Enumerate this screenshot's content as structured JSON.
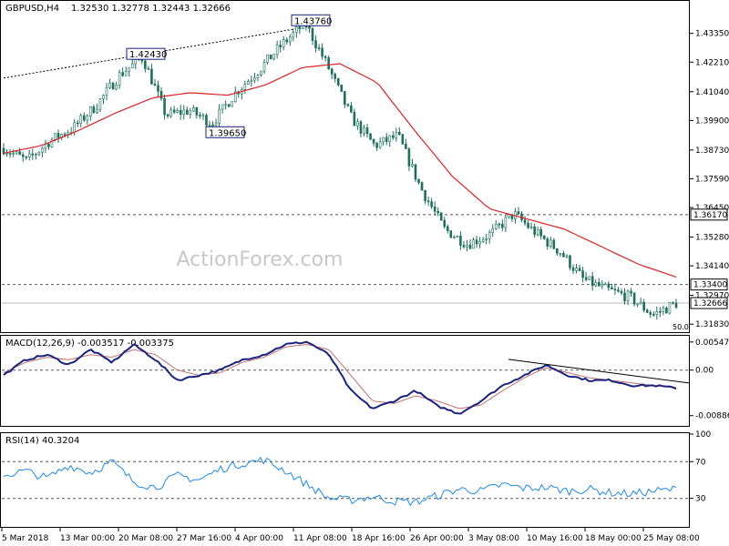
{
  "header": {
    "symbol_tf": "GBPUSD,H4",
    "ohlc": "1.32530 1.32778 1.32443 1.32666"
  },
  "watermark": "ActionForex.com",
  "colors": {
    "candle": "#1f6f5c",
    "ma": "#dd2222",
    "macd": "#1a237e",
    "signal": "#c07070",
    "rsi": "#1e88e5",
    "guide": "#555555",
    "label_border": "#1a237e"
  },
  "chart_data": [
    {
      "type": "candlestick",
      "title": "GBPUSD,H4",
      "ylim": [
        1.3155,
        1.446
      ],
      "y_ticks": [
        "1.43350",
        "1.42210",
        "1.41040",
        "1.39900",
        "1.38730",
        "1.37590",
        "1.36450",
        "1.35280",
        "1.34140",
        "1.32970",
        "1.31830"
      ],
      "x_ticks": [
        "5 Mar 2018",
        "13 Mar 00:00",
        "20 Mar 08:00",
        "27 Mar 16:00",
        "4 Apr 00:00",
        "11 Apr 08:00",
        "18 Apr 16:00",
        "26 Apr 00:00",
        "3 May 08:00",
        "10 May 16:00",
        "18 May 00:00",
        "25 May 08:00"
      ],
      "series": [
        {
          "name": "",
          "kind": "moving-average",
          "values": [
            1.386,
            1.389,
            1.395,
            1.402,
            1.408,
            1.41,
            1.409,
            1.413,
            1.42,
            1.4215,
            1.414,
            1.395,
            1.377,
            1.364,
            1.36,
            1.356,
            1.349,
            1.342,
            1.337
          ]
        }
      ],
      "close_path": [
        1.388,
        1.383,
        1.391,
        1.396,
        1.405,
        1.417,
        1.424,
        1.401,
        1.403,
        1.398,
        1.41,
        1.419,
        1.429,
        1.4376,
        1.42,
        1.4,
        1.389,
        1.393,
        1.372,
        1.356,
        1.35,
        1.354,
        1.362,
        1.354,
        1.347,
        1.336,
        1.332,
        1.329,
        1.322,
        1.3266
      ],
      "horizontal_levels": [
        "1.36170",
        "1.33400"
      ],
      "current_price": "1.32666",
      "price_labels": [
        "1.43760",
        "1.42430",
        "1.39650"
      ],
      "annotations": [
        "50.0"
      ]
    },
    {
      "type": "line",
      "title": "MACD(12,26,9) -0.003517 -0.003375",
      "ylim": [
        -0.0105,
        0.0065
      ],
      "y_ticks": [
        "0.00547",
        "0.00",
        "-0.00886"
      ],
      "series": [
        {
          "name": "",
          "values": [
            -0.001,
            0.002,
            0.003,
            0.001,
            0.004,
            0.0015,
            0.005,
            0.002,
            -0.002,
            -0.001,
            0.0,
            0.002,
            0.003,
            0.005,
            0.0055,
            0.003,
            -0.004,
            -0.0075,
            -0.006,
            -0.004,
            -0.007,
            -0.0085,
            -0.006,
            -0.003,
            -0.001,
            0.001,
            -0.001,
            -0.002,
            -0.002,
            -0.003,
            -0.003,
            -0.0035
          ]
        },
        {
          "name": "",
          "values": [
            -0.0005,
            0.0015,
            0.0025,
            0.002,
            0.003,
            0.0025,
            0.004,
            0.003,
            0.0,
            -0.001,
            -0.0005,
            0.0015,
            0.0025,
            0.0045,
            0.005,
            0.004,
            -0.001,
            -0.006,
            -0.0065,
            -0.005,
            -0.006,
            -0.0075,
            -0.0068,
            -0.004,
            -0.0015,
            0.0005,
            -0.0005,
            -0.0015,
            -0.002,
            -0.0025,
            -0.003,
            -0.0034
          ]
        }
      ]
    },
    {
      "type": "line",
      "title": "RSI(14) 40.3204",
      "ylim": [
        0,
        100
      ],
      "y_ticks": [
        "100",
        "70",
        "30",
        "0"
      ],
      "series": [
        {
          "name": "",
          "values": [
            55,
            60,
            52,
            66,
            58,
            70,
            48,
            42,
            55,
            50,
            62,
            68,
            72,
            60,
            45,
            30,
            28,
            32,
            27,
            26,
            33,
            40,
            38,
            45,
            41,
            42,
            38,
            40,
            36,
            35,
            38,
            40
          ]
        }
      ]
    }
  ]
}
